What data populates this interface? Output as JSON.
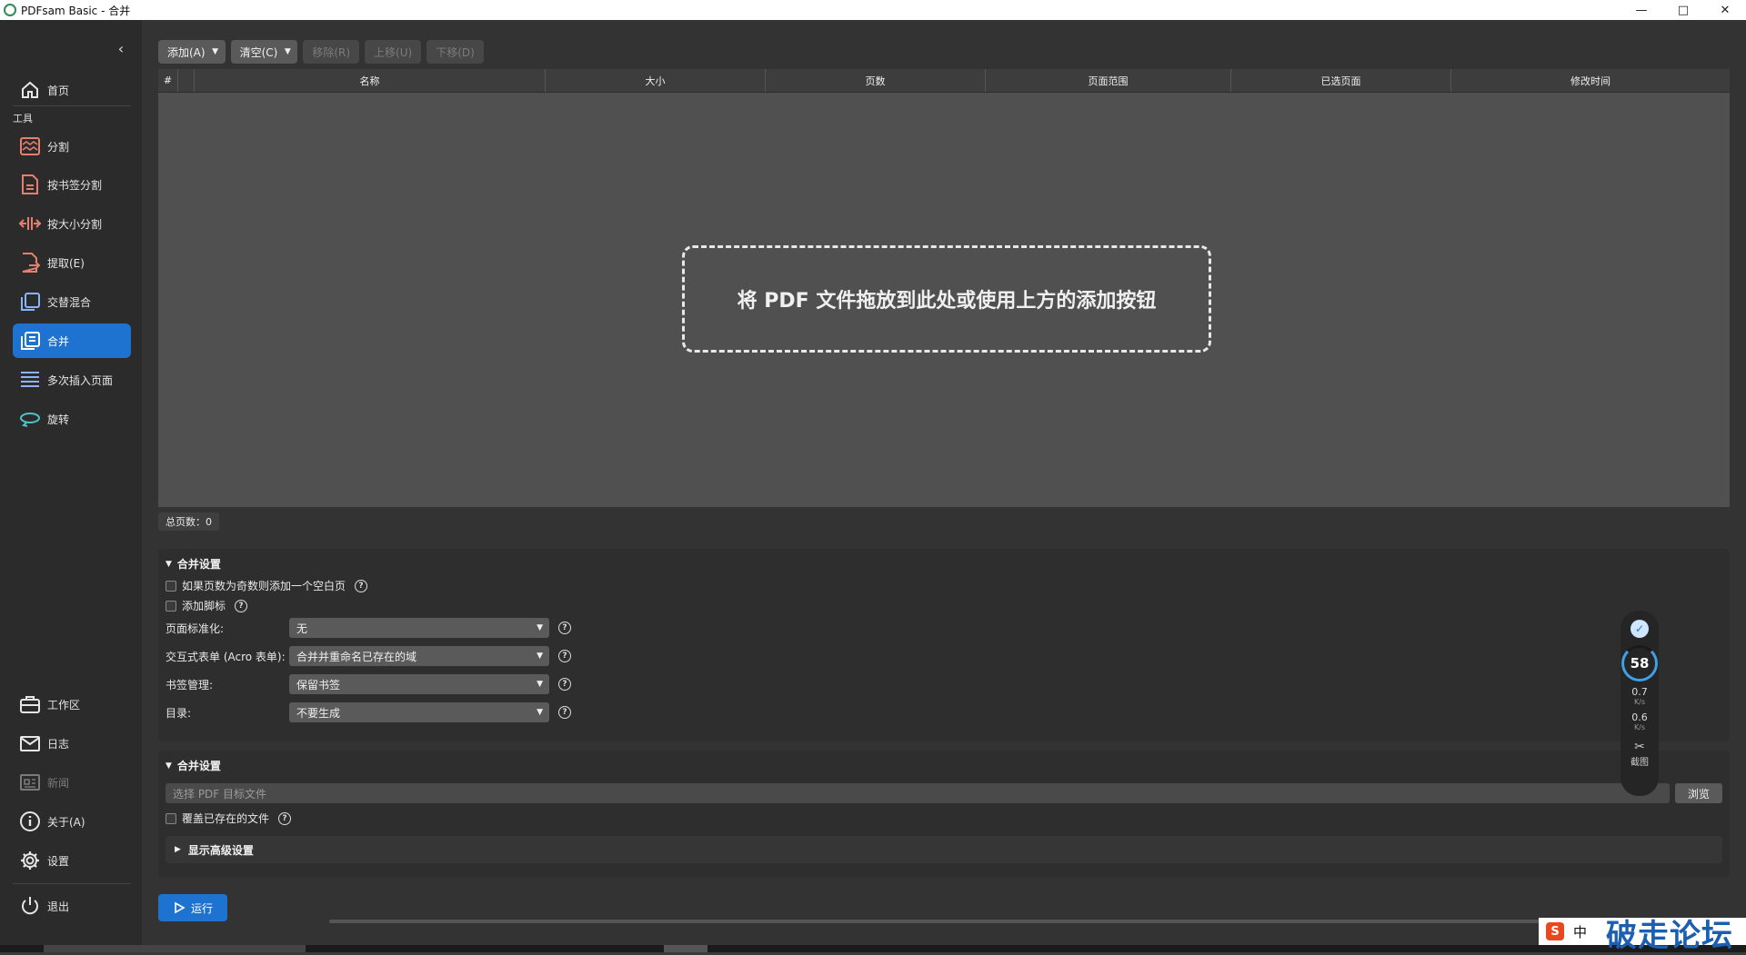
{
  "window": {
    "title": "PDFsam Basic - 合并",
    "controls": [
      "minimize-icon",
      "maximize-icon",
      "close-icon"
    ]
  },
  "sidebar": {
    "collapse_icon": "chevron-left-icon",
    "home": {
      "label": "首页",
      "icon": "home-icon"
    },
    "tools_label": "工具",
    "items": [
      {
        "label": "分割",
        "icon": "split-icon"
      },
      {
        "label": "按书签分割",
        "icon": "bookmark-split-icon"
      },
      {
        "label": "按大小分割",
        "icon": "size-split-icon"
      },
      {
        "label": "提取(E)",
        "icon": "extract-icon"
      },
      {
        "label": "交替混合",
        "icon": "alternate-mix-icon"
      },
      {
        "label": "合并",
        "icon": "merge-icon",
        "active": true
      },
      {
        "label": "多次插入页面",
        "icon": "insert-pages-icon"
      },
      {
        "label": "旋转",
        "icon": "rotate-icon"
      }
    ],
    "bottom": [
      {
        "label": "工作区",
        "icon": "briefcase-icon"
      },
      {
        "label": "日志",
        "icon": "mail-icon"
      },
      {
        "label": "新闻",
        "icon": "news-icon",
        "disabled": true
      },
      {
        "label": "关于(A)",
        "icon": "info-icon"
      },
      {
        "label": "设置",
        "icon": "gear-icon"
      },
      {
        "label": "退出",
        "icon": "power-icon"
      }
    ],
    "accent": "#1e73d1"
  },
  "toolbar": {
    "add": "添加(A)",
    "clear": "清空(C)",
    "remove": "移除(R)",
    "move_up": "上移(U)",
    "move_down": "下移(D)"
  },
  "table": {
    "columns": [
      "#",
      "",
      "名称",
      "大小",
      "页数",
      "页面范围",
      "已选页面",
      "修改时间"
    ],
    "rows": [],
    "dropzone_text": "将 PDF 文件拖放到此处或使用上方的添加按钮"
  },
  "total_pages": "总页数：0",
  "merge_settings": {
    "title": "合并设置",
    "blank_page_checkbox": "如果页数为奇数则添加一个空白页",
    "footer_checkbox": "添加脚标",
    "page_normalization": {
      "label": "页面标准化:",
      "value": "无"
    },
    "acroforms": {
      "label": "交互式表单 (Acro 表单):",
      "value": "合并并重命名已存在的域"
    },
    "bookmarks": {
      "label": "书签管理:",
      "value": "保留书签"
    },
    "toc": {
      "label": "目录:",
      "value": "不要生成"
    }
  },
  "output_settings": {
    "title": "合并设置",
    "dest_placeholder": "选择 PDF 目标文件",
    "browse": "浏览",
    "overwrite_checkbox": "覆盖已存在的文件",
    "advanced": "显示高级设置"
  },
  "run_button": "运行",
  "float_widget": {
    "score": "58",
    "upload_speed": "0.7",
    "download_speed": "0.6",
    "speed_unit": "K/s",
    "screenshot_label": "截图"
  },
  "ime": {
    "logo": "S",
    "mode": "中"
  },
  "watermark": "破走论坛"
}
